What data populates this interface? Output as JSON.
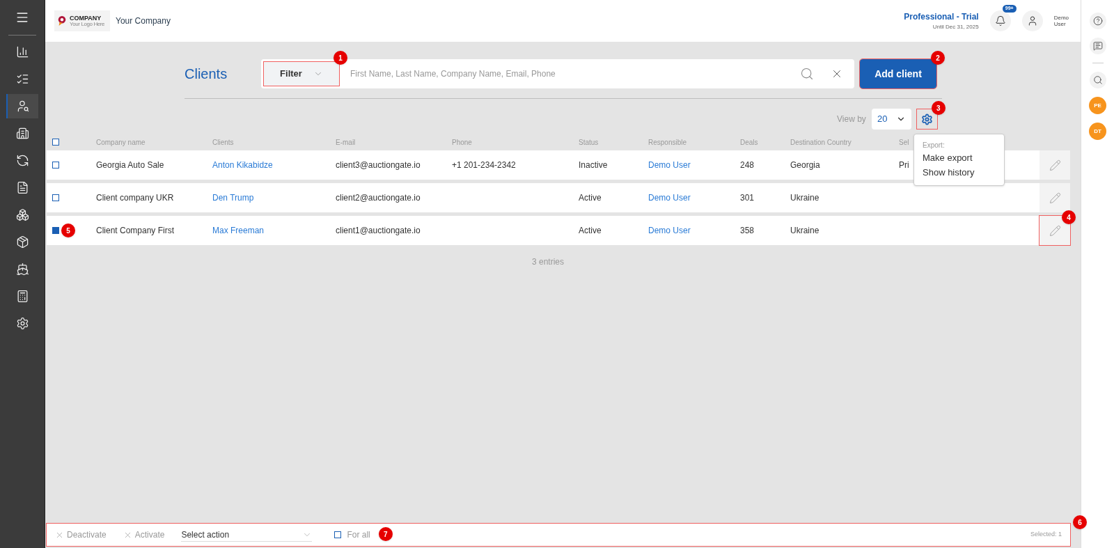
{
  "header": {
    "logo": {
      "word": "COMPANY",
      "tagline": "Your Logo Here"
    },
    "company_name": "Your Company",
    "plan": {
      "name": "Professional - Trial",
      "until": "Until Dec 31, 2025"
    },
    "notifications_badge": "99+",
    "user": {
      "first": "Demo",
      "last": "User"
    }
  },
  "sidebar": {
    "items": [
      {
        "selected": false
      },
      {
        "selected": false
      },
      {
        "selected": true
      },
      {
        "selected": false
      },
      {
        "selected": false
      },
      {
        "selected": false
      },
      {
        "selected": false
      },
      {
        "selected": false
      },
      {
        "selected": false
      },
      {
        "selected": false
      },
      {
        "selected": false
      }
    ]
  },
  "right_rail": {
    "avatars": [
      {
        "initials": "PE",
        "color": "#f7941d"
      },
      {
        "initials": "DT",
        "color": "#f7941d"
      }
    ]
  },
  "page": {
    "title": "Clients",
    "filter": {
      "label": "Filter",
      "callout": {
        "number": "1",
        "outlined": true
      }
    },
    "search": {
      "placeholder": "First Name, Last Name, Company Name, Email, Phone"
    },
    "add_button": {
      "label": "Add client",
      "callout": {
        "number": "2",
        "outlined": true
      }
    },
    "view_by": {
      "label": "View by",
      "value": "20"
    },
    "settings": {
      "callout": {
        "number": "3",
        "outlined": true
      }
    },
    "export_menu": {
      "heading": "Export:",
      "items": [
        "Make export",
        "Show history"
      ]
    }
  },
  "table": {
    "select_all": {
      "checked": false
    },
    "columns": [
      "Company name",
      "Clients",
      "E-mail",
      "Phone",
      "Status",
      "Responsible",
      "Deals",
      "Destination Country",
      "Sel"
    ],
    "rows": [
      {
        "selected": false,
        "company": "Georgia Auto Sale",
        "client": "Anton Kikabidze",
        "email": "client3@auctiongate.io",
        "phone": "+1 201-234-2342",
        "status": "Inactive",
        "responsible": "Demo User",
        "deals": "248",
        "country": "Georgia",
        "column_9": "Pri"
      },
      {
        "selected": false,
        "company": "Client company UKR",
        "client": "Den Trump",
        "email": "client2@auctiongate.io",
        "status": "Active",
        "responsible": "Demo User",
        "deals": "301",
        "country": "Ukraine"
      },
      {
        "selected": true,
        "company": "Client Company First",
        "client": "Max Freeman",
        "email": "client1@auctiongate.io",
        "status": "Active",
        "responsible": "Demo User",
        "deals": "358",
        "country": "Ukraine",
        "checkbox_callout": {
          "number": "5"
        },
        "edit_callout": {
          "number": "4",
          "outlined": true
        }
      }
    ],
    "entries": "3 entries"
  },
  "bottom_bar": {
    "callout": {
      "number": "6",
      "outlined": true
    },
    "deactivate": "Deactivate",
    "activate": "Activate",
    "select_action": {
      "placeholder": "Select action"
    },
    "for_all": {
      "label": "For all",
      "checked": false,
      "callout": {
        "number": "7"
      }
    },
    "selected_count": "Selected: 1"
  }
}
